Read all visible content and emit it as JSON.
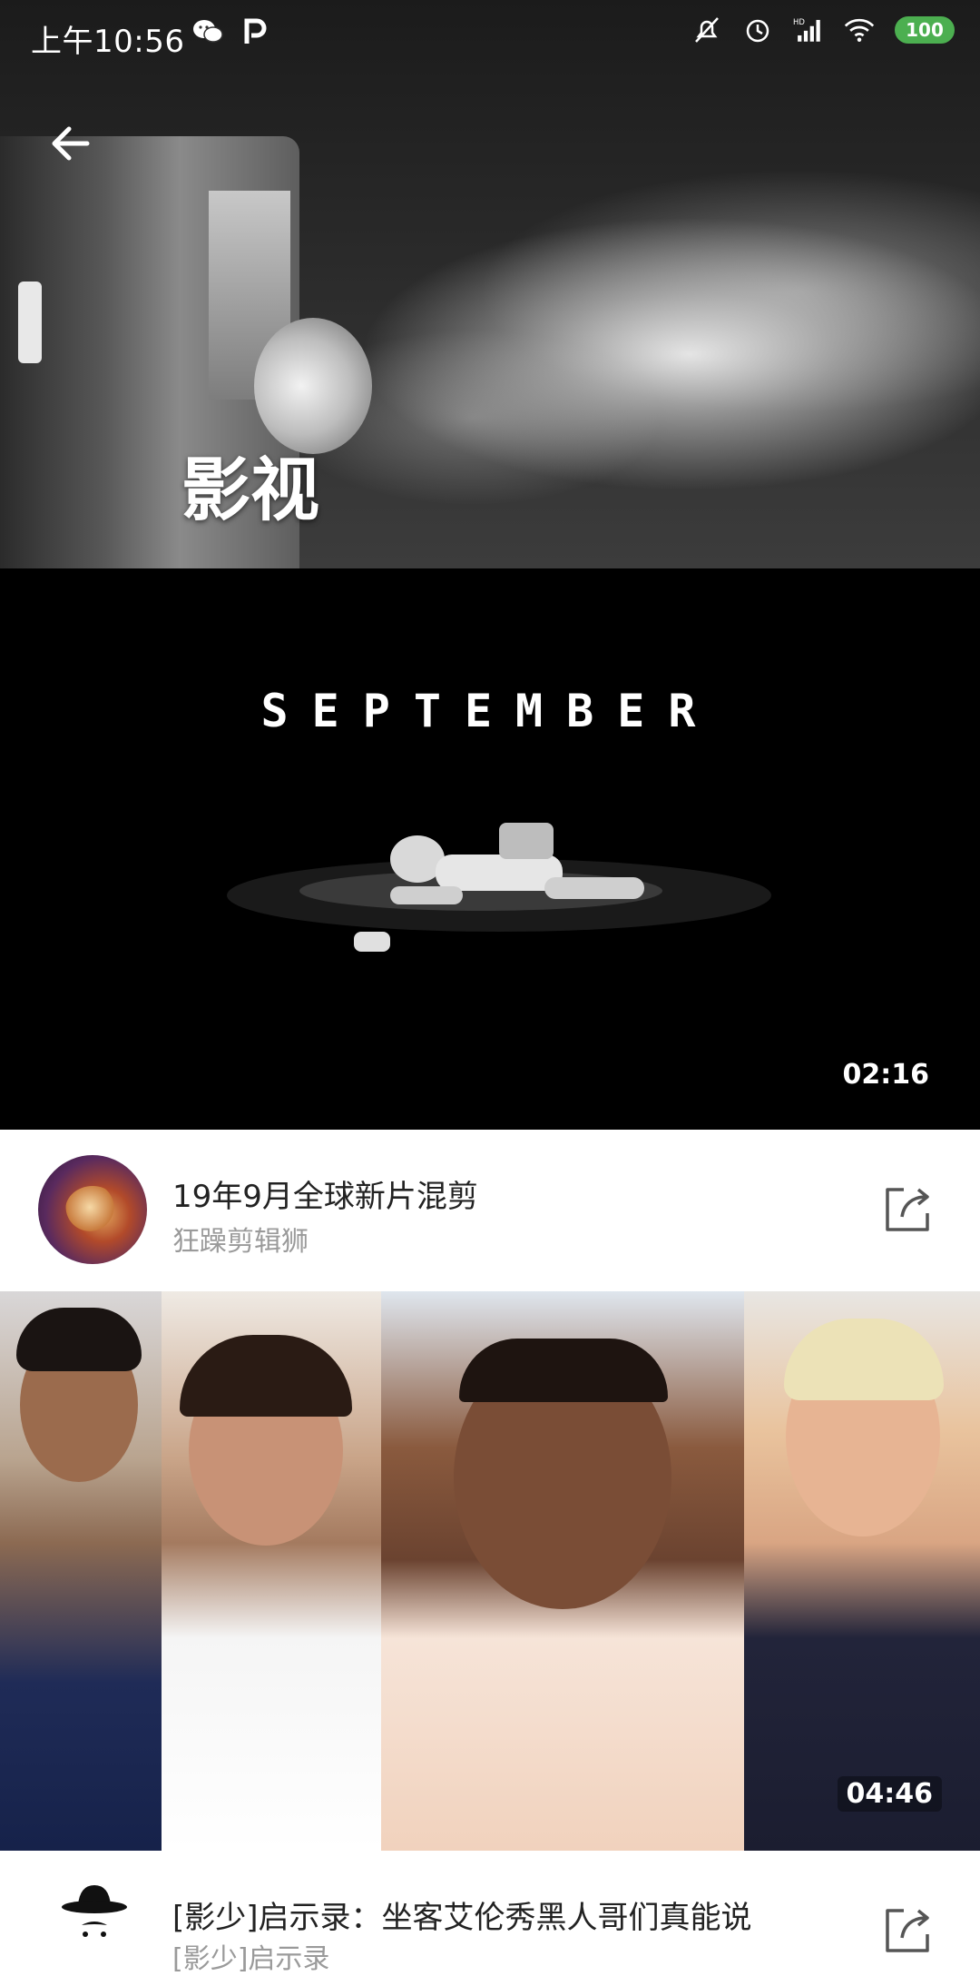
{
  "status_bar": {
    "time": "上午10:56",
    "battery": "100",
    "left_icons": [
      "wechat-icon",
      "p-app-icon"
    ],
    "right_icons": [
      "mute-icon",
      "alarm-icon",
      "hd-signal-icon",
      "wifi-icon",
      "battery-icon"
    ]
  },
  "header": {
    "title": "影视"
  },
  "videos": [
    {
      "thumb_text": "SEPTEMBER",
      "duration": "02:16",
      "title": "19年9月全球新片混剪",
      "channel": "狂躁剪辑狮"
    },
    {
      "duration": "04:46",
      "title": "[影少]启示录：坐客艾伦秀黑人哥们真能说",
      "channel": "[影少]启示录"
    }
  ],
  "colors": {
    "battery": "#4caf50",
    "background": "#ffffff",
    "title_text": "#222222",
    "channel_text": "#9a9a9a"
  }
}
